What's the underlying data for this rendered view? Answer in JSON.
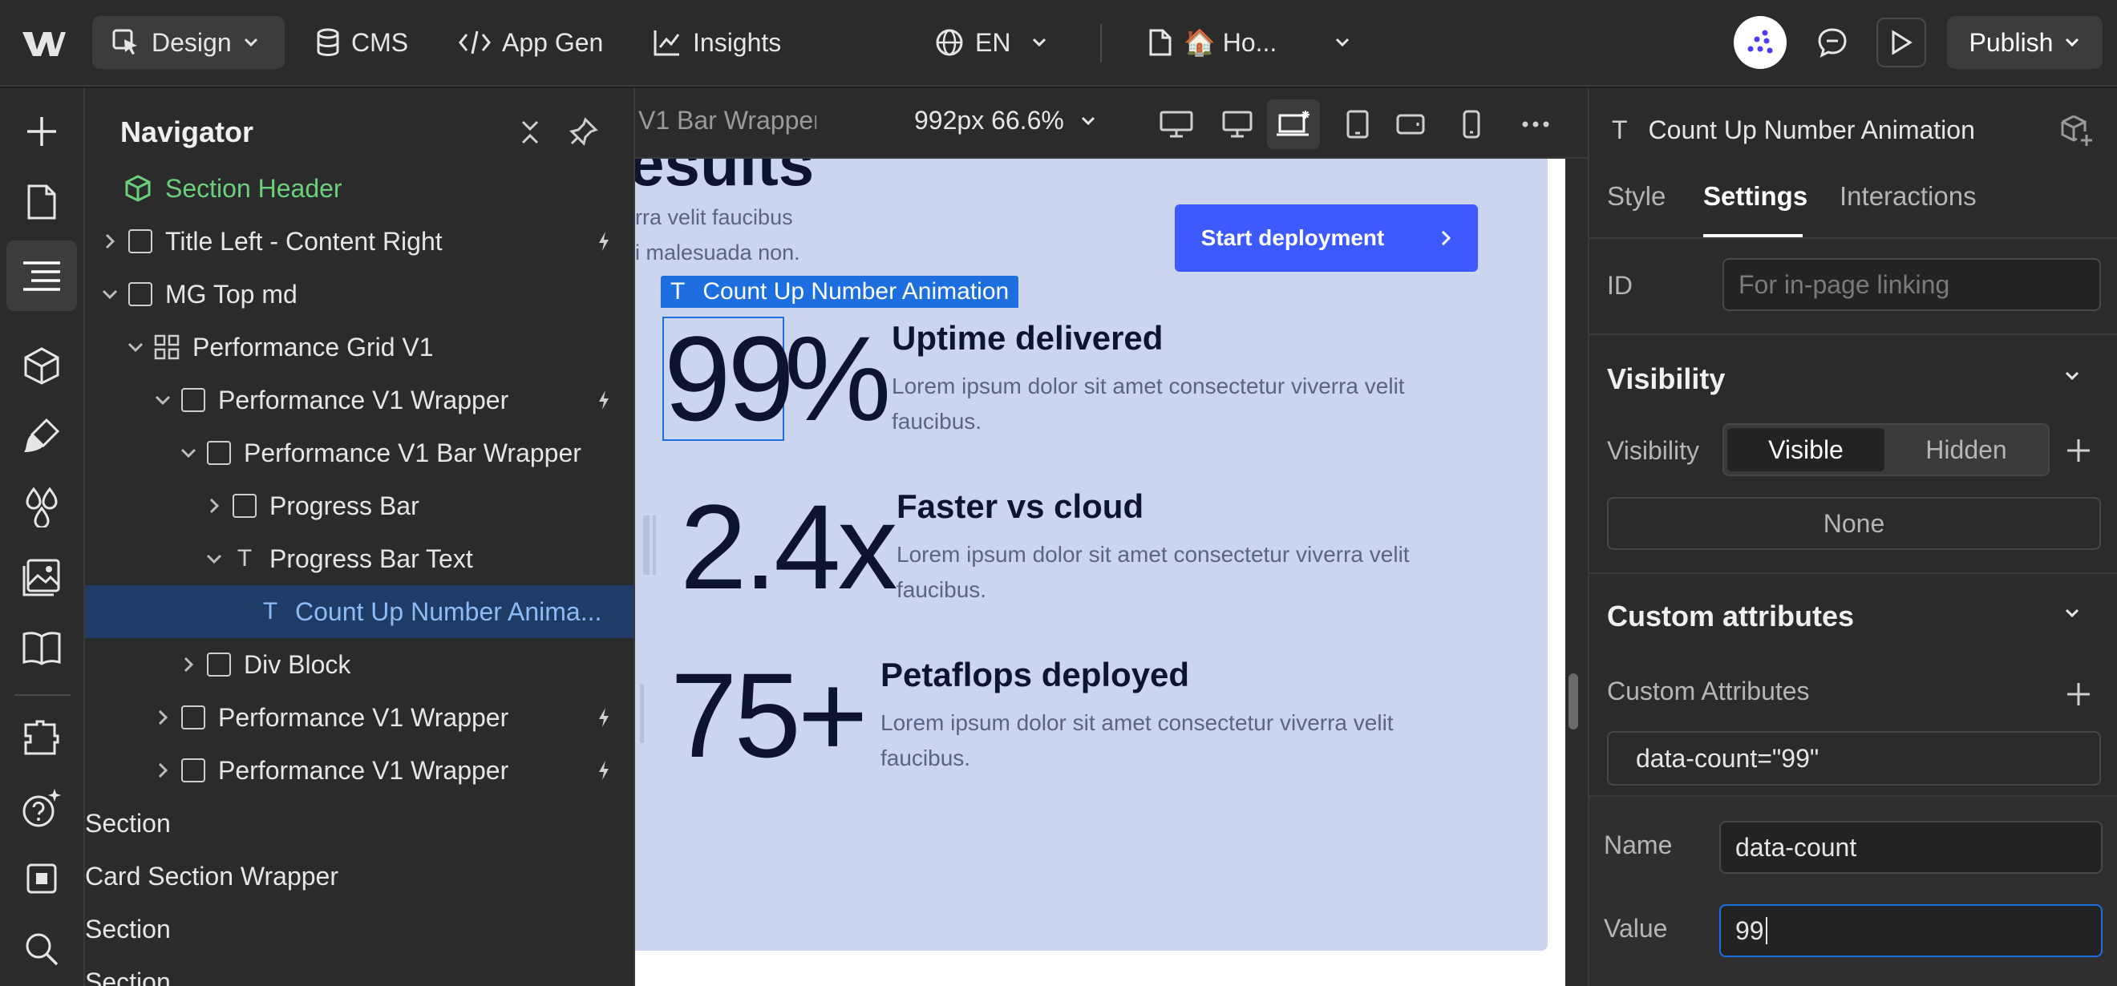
{
  "topbar": {
    "design_label": "Design",
    "cms_label": "CMS",
    "appgen_label": "App Gen",
    "insights_label": "Insights",
    "lang_label": "EN",
    "page_label": "🏠 Ho...",
    "publish_label": "Publish"
  },
  "navigator": {
    "title": "Navigator",
    "items": [
      {
        "label": "Section Header"
      },
      {
        "label": "Title Left - Content Right"
      },
      {
        "label": "MG Top md"
      },
      {
        "label": "Performance Grid V1"
      },
      {
        "label": "Performance V1 Wrapper"
      },
      {
        "label": "Performance V1 Bar Wrapper"
      },
      {
        "label": "Progress Bar"
      },
      {
        "label": "Progress Bar Text"
      },
      {
        "label": "Count Up Number Anima..."
      },
      {
        "label": "Div Block"
      },
      {
        "label": "Performance V1 Wrapper"
      },
      {
        "label": "Performance V1 Wrapper"
      },
      {
        "label": "Section"
      },
      {
        "label": "Card Section Wrapper"
      },
      {
        "label": "Section"
      },
      {
        "label": "Section"
      }
    ]
  },
  "canvas_bar": {
    "breadcrumb": "V1 Bar Wrapper",
    "size_label": "992px 66.6%"
  },
  "canvas": {
    "heading_fragment": "esults",
    "intro_line1": "rra velit faucibus",
    "intro_line2": "i malesuada non.",
    "cta_label": "Start deployment",
    "selection_label": "Count Up Number Animation",
    "stats": [
      {
        "number": "99",
        "suffix": "%",
        "title": "Uptime delivered",
        "desc1": "Lorem ipsum dolor sit amet consectetur viverra velit",
        "desc2": "faucibus."
      },
      {
        "number": "2.4x",
        "title": "Faster vs cloud",
        "desc1": "Lorem ipsum dolor sit amet consectetur viverra velit",
        "desc2": "faucibus."
      },
      {
        "number": "75+",
        "title": "Petaflops deployed",
        "desc1": "Lorem ipsum dolor sit amet consectetur viverra velit",
        "desc2": "faucibus."
      }
    ]
  },
  "panel": {
    "element_title": "Count Up Number Animation",
    "tabs": [
      "Style",
      "Settings",
      "Interactions"
    ],
    "id_label": "ID",
    "id_placeholder": "For in-page linking",
    "visibility_section": "Visibility",
    "visibility_label": "Visibility",
    "visible_option": "Visible",
    "hidden_option": "Hidden",
    "none_label": "None",
    "custom_attr_section": "Custom attributes",
    "custom_attr_label": "Custom Attributes",
    "attr_entry": "data-count=\"99\"",
    "name_label": "Name",
    "name_value": "data-count",
    "value_label": "Value",
    "value_value": "99"
  },
  "colors": {
    "accent_blue": "#3d5afe",
    "selection_blue": "#1d6fe0",
    "canvas_bg": "#ccd5ef",
    "nav_selected": "#1f3c66",
    "section_header_green": "#6ad17a"
  }
}
